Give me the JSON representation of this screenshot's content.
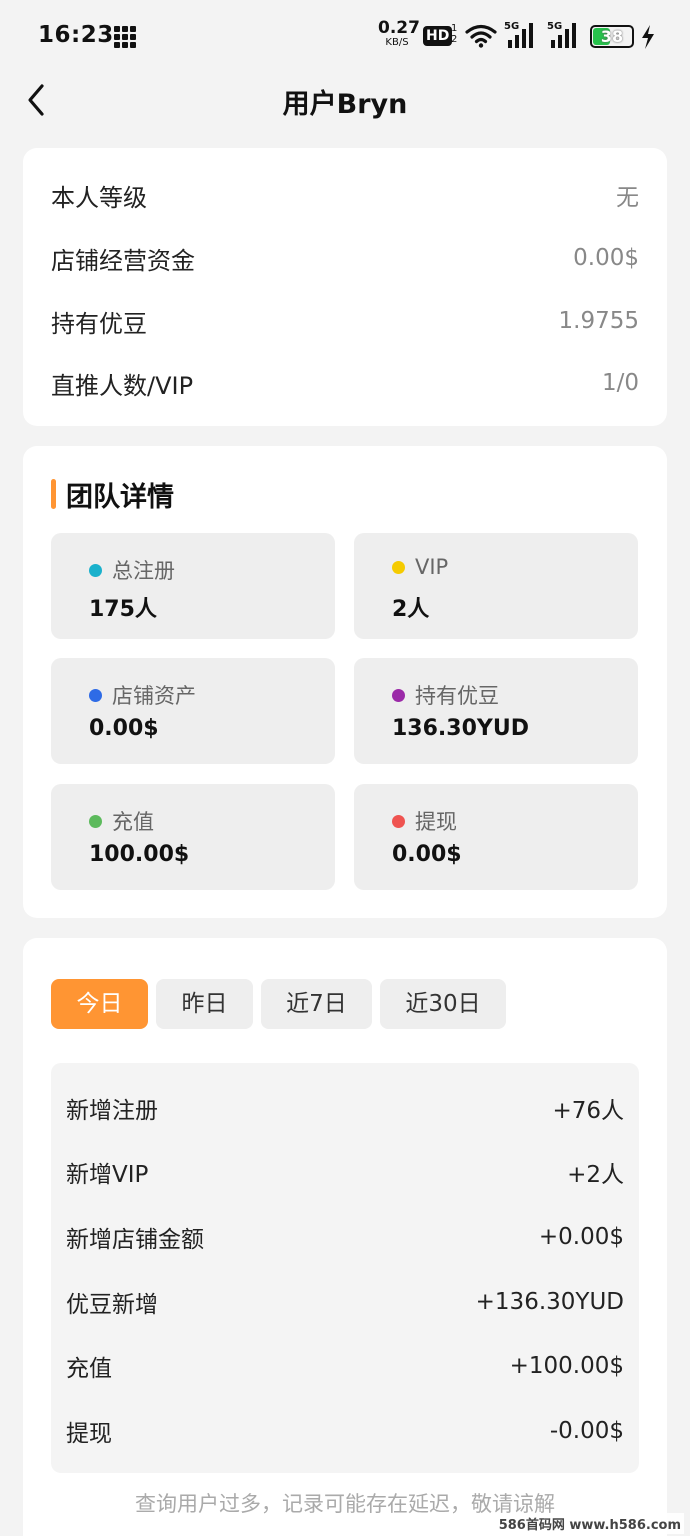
{
  "status_bar": {
    "time": "16:23",
    "net_speed": "0.27",
    "net_unit": "KB/S",
    "hd_label": "HD",
    "hd_sub": "1\n2",
    "sig1_label": "5G",
    "sig2_label": "5G",
    "battery": "38"
  },
  "header": {
    "title": "用户Bryn"
  },
  "profile": {
    "rows": [
      {
        "label": "本人等级",
        "value": "无"
      },
      {
        "label": "店铺经营资金",
        "value": "0.00$"
      },
      {
        "label": "持有优豆",
        "value": "1.9755"
      },
      {
        "label": "直推人数/VIP",
        "value": "1/0"
      }
    ]
  },
  "team": {
    "title": "团队详情",
    "accent": "#ff9533",
    "stats": [
      {
        "label": "总注册",
        "value": "175人",
        "color": "#1ab1cc"
      },
      {
        "label": "VIP",
        "value": "2人",
        "color": "#f5cb00"
      },
      {
        "label": "店铺资产",
        "value": "0.00$",
        "color": "#2e6be6"
      },
      {
        "label": "持有优豆",
        "value": "136.30YUD",
        "color": "#9b2aa8"
      },
      {
        "label": "充值",
        "value": "100.00$",
        "color": "#5cba5c"
      },
      {
        "label": "提现",
        "value": "0.00$",
        "color": "#ef5350"
      }
    ]
  },
  "period": {
    "tabs": [
      {
        "label": "今日",
        "active": true
      },
      {
        "label": "昨日",
        "active": false
      },
      {
        "label": "近7日",
        "active": false
      },
      {
        "label": "近30日",
        "active": false
      }
    ],
    "rows": [
      {
        "label": "新增注册",
        "value": "+76人"
      },
      {
        "label": "新增VIP",
        "value": "+2人"
      },
      {
        "label": "新增店铺金额",
        "value": "+0.00$"
      },
      {
        "label": "优豆新增",
        "value": "+136.30YUD"
      },
      {
        "label": "充值",
        "value": "+100.00$"
      },
      {
        "label": "提现",
        "value": "-0.00$"
      }
    ]
  },
  "notice": "查询用户过多，记录可能存在延迟，敬请谅解",
  "watermark": "586首码网 www.h586.com"
}
